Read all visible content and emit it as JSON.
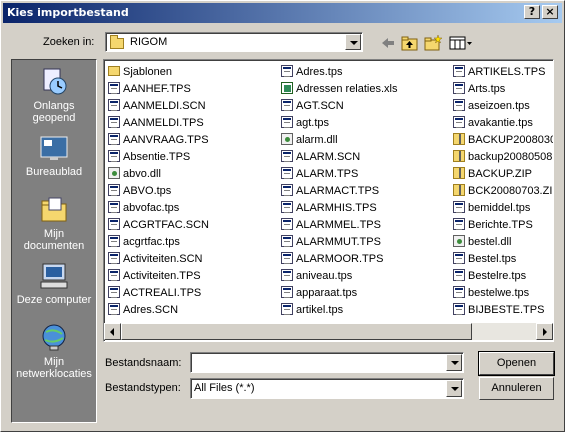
{
  "window": {
    "title": "Kies importbestand"
  },
  "title_buttons": {
    "help": "?",
    "close": "×"
  },
  "lookin": {
    "label": "Zoeken in:",
    "value": "RIGOM"
  },
  "places": [
    {
      "label_line1": "Onlangs",
      "label_line2": "geopend",
      "icon": "recent-documents-icon"
    },
    {
      "label_line1": "Bureaublad",
      "label_line2": "",
      "icon": "desktop-icon"
    },
    {
      "label_line1": "Mijn",
      "label_line2": "documenten",
      "icon": "my-documents-icon"
    },
    {
      "label_line1": "Deze computer",
      "label_line2": "",
      "icon": "my-computer-icon"
    },
    {
      "label_line1": "Mijn",
      "label_line2": "netwerklocaties",
      "icon": "network-places-icon"
    }
  ],
  "files": {
    "col1": [
      {
        "name": "Sjablonen",
        "type": "folder"
      },
      {
        "name": "AANHEF.TPS",
        "type": "doc"
      },
      {
        "name": "AANMELDI.SCN",
        "type": "doc"
      },
      {
        "name": "AANMELDI.TPS",
        "type": "doc"
      },
      {
        "name": "AANVRAAG.TPS",
        "type": "doc"
      },
      {
        "name": "Absentie.TPS",
        "type": "doc"
      },
      {
        "name": "abvo.dll",
        "type": "dll"
      },
      {
        "name": "ABVO.tps",
        "type": "doc"
      },
      {
        "name": "abvofac.tps",
        "type": "doc"
      },
      {
        "name": "ACGRTFAC.SCN",
        "type": "doc"
      },
      {
        "name": "acgrtfac.tps",
        "type": "doc"
      },
      {
        "name": "Activiteiten.SCN",
        "type": "doc"
      },
      {
        "name": "Activiteiten.TPS",
        "type": "doc"
      },
      {
        "name": "ACTREALI.TPS",
        "type": "doc"
      },
      {
        "name": "Adres.SCN",
        "type": "doc"
      }
    ],
    "col2": [
      {
        "name": "Adres.tps",
        "type": "doc"
      },
      {
        "name": "Adressen relaties.xls",
        "type": "xls"
      },
      {
        "name": "AGT.SCN",
        "type": "doc"
      },
      {
        "name": "agt.tps",
        "type": "doc"
      },
      {
        "name": "alarm.dll",
        "type": "dll"
      },
      {
        "name": "ALARM.SCN",
        "type": "doc"
      },
      {
        "name": "ALARM.TPS",
        "type": "doc"
      },
      {
        "name": "ALARMACT.TPS",
        "type": "doc"
      },
      {
        "name": "ALARMHIS.TPS",
        "type": "doc"
      },
      {
        "name": "ALARMMEL.TPS",
        "type": "doc"
      },
      {
        "name": "ALARMMUT.TPS",
        "type": "doc"
      },
      {
        "name": "ALARMOOR.TPS",
        "type": "doc"
      },
      {
        "name": "aniveau.tps",
        "type": "doc"
      },
      {
        "name": "apparaat.tps",
        "type": "doc"
      },
      {
        "name": "artikel.tps",
        "type": "doc"
      }
    ],
    "col3": [
      {
        "name": "ARTIKELS.TPS",
        "type": "doc"
      },
      {
        "name": "Arts.tps",
        "type": "doc"
      },
      {
        "name": "aseizoen.tps",
        "type": "doc"
      },
      {
        "name": "avakantie.tps",
        "type": "doc"
      },
      {
        "name": "BACKUP2008030",
        "type": "zip"
      },
      {
        "name": "backup20080508",
        "type": "zip"
      },
      {
        "name": "BACKUP.ZIP",
        "type": "zip"
      },
      {
        "name": "BCK20080703.ZI",
        "type": "zip"
      },
      {
        "name": "bemiddel.tps",
        "type": "doc"
      },
      {
        "name": "Berichte.TPS",
        "type": "doc"
      },
      {
        "name": "bestel.dll",
        "type": "dll"
      },
      {
        "name": "Bestel.tps",
        "type": "doc"
      },
      {
        "name": "Bestelre.tps",
        "type": "doc"
      },
      {
        "name": "bestelwe.tps",
        "type": "doc"
      },
      {
        "name": "BIJBESTE.TPS",
        "type": "doc"
      }
    ]
  },
  "filename": {
    "label": "Bestandsnaam:",
    "value": ""
  },
  "filetype": {
    "label": "Bestandstypen:",
    "value": "All Files (*.*)"
  },
  "buttons": {
    "open": "Openen",
    "cancel": "Annuleren"
  }
}
